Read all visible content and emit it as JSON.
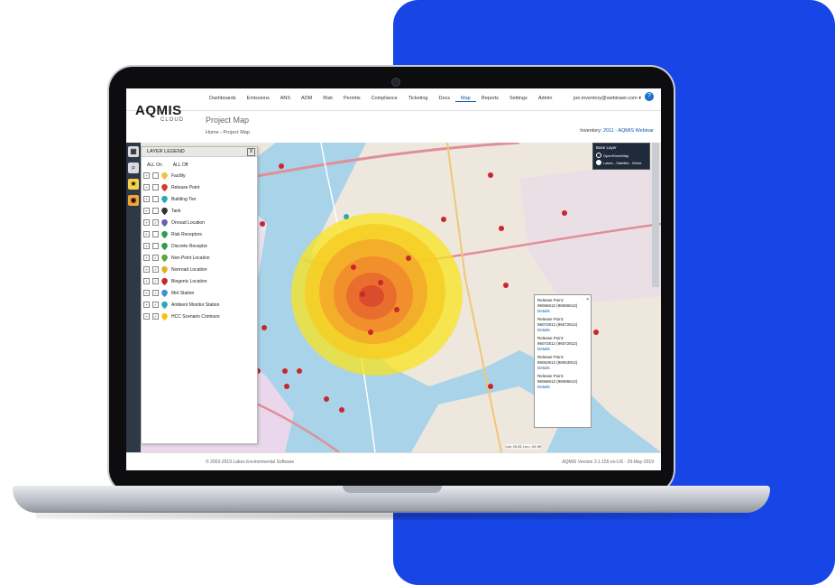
{
  "app": {
    "logo": "AQMIS",
    "logo_sub": "CLOUD",
    "nav": [
      "Dashboards",
      "Emissions",
      "ANS",
      "ADM",
      "Risk",
      "Permits",
      "Compliance",
      "Ticketing",
      "Docs",
      "Map",
      "Reports",
      "Settings",
      "Admin"
    ],
    "active_nav": "Map",
    "user": "joe.inventory@webinaer.com ▾",
    "help": "?",
    "page_title": "Project Map",
    "breadcrumb": "Home  ›  Project Map",
    "inventory_label": "Inventory:",
    "inventory_value": "2011 - AQMIS Webinar",
    "footer_left": "© 2003-2019 Lakes Environmental Software",
    "footer_right": "AQMIS Version 3.1.155 en-US - 29-May-2019"
  },
  "legend": {
    "title": "LAYER LEGEND",
    "close": "X",
    "all_on": "ALL On",
    "all_off": "ALL Off",
    "items": [
      {
        "label": "Facility",
        "color": "#f0c23c"
      },
      {
        "label": "Release Point",
        "color": "#d43b2f"
      },
      {
        "label": "Building Tier",
        "color": "#2aa9b4"
      },
      {
        "label": "Tank",
        "color": "#333333"
      },
      {
        "label": "Onroad Location",
        "color": "#6b5fb5"
      },
      {
        "label": "Risk Receptors",
        "color": "#2e9d4c"
      },
      {
        "label": "Discrete Receptor",
        "color": "#2e9d4c"
      },
      {
        "label": "Non-Point Location",
        "color": "#5aa83a"
      },
      {
        "label": "Nonroad Location",
        "color": "#e0b21f"
      },
      {
        "label": "Biogenic Location",
        "color": "#c9262d"
      },
      {
        "label": "Met Station",
        "color": "#3f8fd2"
      },
      {
        "label": "Ambient Monitor Station",
        "color": "#2aa9b4"
      },
      {
        "label": "HCC Scenario Contours",
        "color": "#f3c21a"
      }
    ]
  },
  "base_layer": {
    "title": "Base Layer",
    "options": [
      "OpenStreetMap",
      "Lakes - Satellite - World"
    ]
  },
  "popup": {
    "entries": [
      {
        "label": "Release Point:",
        "value": "96066612 (96066612)",
        "link": "Details"
      },
      {
        "label": "Release Point:",
        "value": "96072812 (96072812)",
        "link": "Details"
      },
      {
        "label": "Release Point:",
        "value": "96072812 (96072812)",
        "link": "Details"
      },
      {
        "label": "Release Point:",
        "value": "96063912 (96063912)",
        "link": "Details"
      },
      {
        "label": "Release Point:",
        "value": "96066612 (96066612)",
        "link": "Details"
      }
    ]
  },
  "scale_text": "Lat: 29.81 Lon: -94.99",
  "colors": {
    "brand_blue": "#1745e6",
    "accent": "#0a58a8",
    "marker_red": "#c9262d"
  }
}
